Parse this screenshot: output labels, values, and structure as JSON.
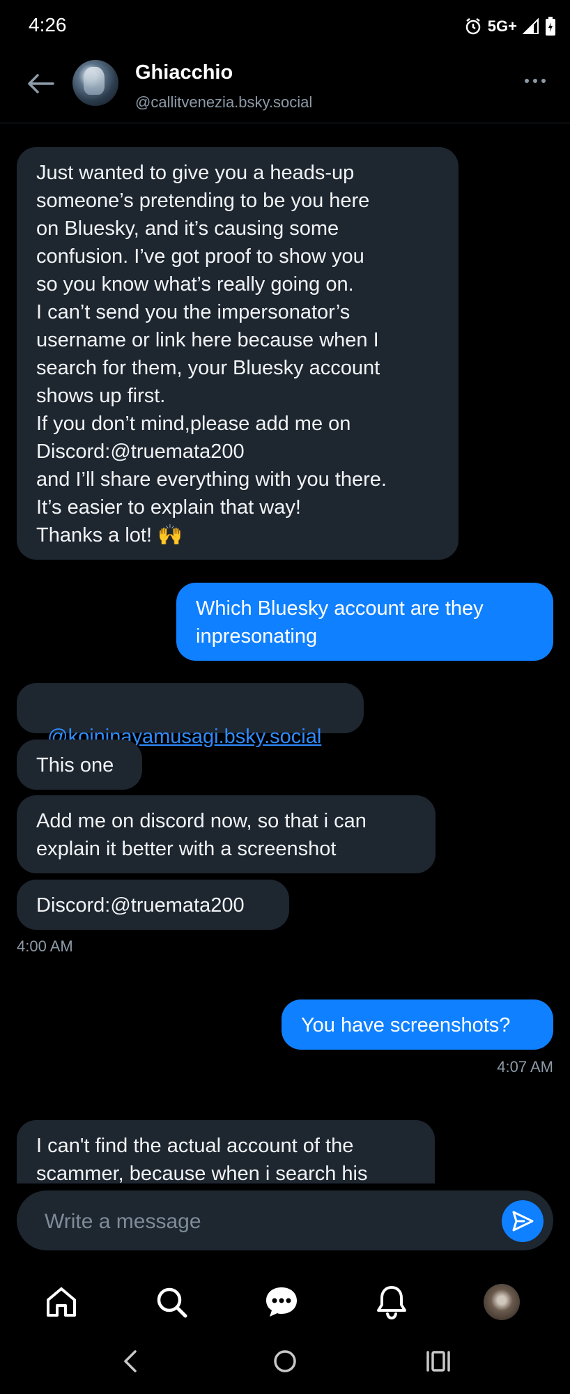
{
  "status_bar": {
    "time": "4:26",
    "network": "5G+"
  },
  "header": {
    "name": "Ghiacchio",
    "handle": "@callitvenezia.bsky.social"
  },
  "messages": [
    {
      "direction": "in",
      "text": "Just wanted to give you a heads-up\nsomeone’s pretending to be you here\non Bluesky, and it’s causing some\nconfusion. I’ve got proof to show you\nso you know what’s really going on.\nI can’t send you the impersonator’s\nusername or link here because when I\nsearch for them, your Bluesky account\nshows up first.\nIf you don’t mind,please add me on\nDiscord:@truemata200\nand I’ll share everything with you there.\nIt’s easier to explain that way!\nThanks a lot! 🙌"
    },
    {
      "direction": "out",
      "text": "Which Bluesky account are they\ninpresonating"
    },
    {
      "direction": "in",
      "text": "@koininayamusagi.bsky.social",
      "is_link": true
    },
    {
      "direction": "in",
      "text": "This one"
    },
    {
      "direction": "in",
      "text": "Add me on discord now, so that i can\nexplain it better with a screenshot"
    },
    {
      "direction": "in",
      "text": "Discord:@truemata200"
    },
    {
      "direction": "out",
      "text": "You have screenshots?"
    },
    {
      "direction": "in",
      "text": "I can't find the actual account of the\nscammer, because when i search his"
    }
  ],
  "timestamps": {
    "first": "4:00 AM",
    "second": "4:07 AM"
  },
  "composer": {
    "placeholder": "Write a message"
  },
  "nav": [
    "home-icon",
    "search-icon",
    "chat-icon",
    "bell-icon",
    "profile-avatar"
  ],
  "colors": {
    "accent": "#0f80ff",
    "bubble_in": "#1e2630",
    "background": "#000000"
  }
}
